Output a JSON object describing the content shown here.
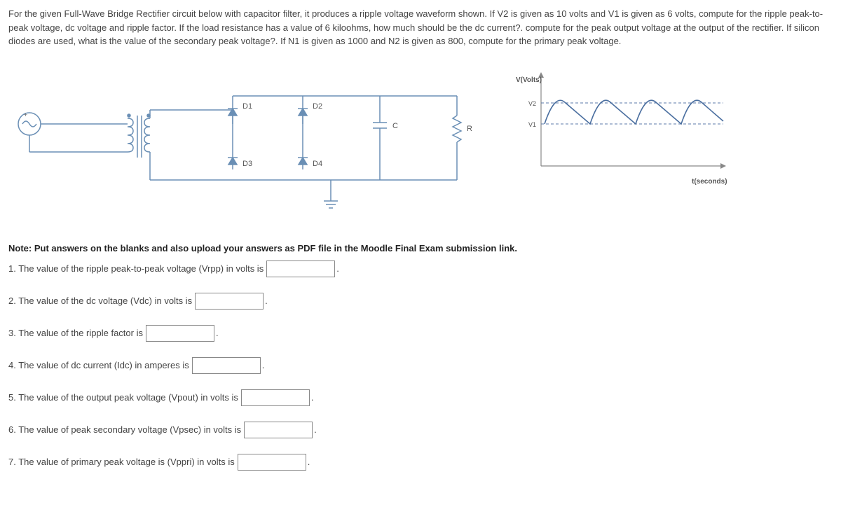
{
  "problem": {
    "text": "For the given Full-Wave Bridge Rectifier circuit below with capacitor filter, it produces a ripple voltage waveform shown. If V2 is given as 10 volts and V1 is given as 6 volts, compute for the ripple peak-to-peak voltage, dc voltage and ripple factor. If the load resistance has a value of 6 kiloohms, how much should be the dc current?. compute for the peak output voltage at the output of the rectifier. If silicon diodes are used, what is the value of the secondary peak voltage?. If N1 is given as 1000 and N2 is given as 800, compute for the primary peak voltage."
  },
  "circuit": {
    "d1": "D1",
    "d2": "D2",
    "d3": "D3",
    "d4": "D4",
    "c": "C",
    "r": "R"
  },
  "waveform": {
    "ylabel": "V(Volts)",
    "v2": "V2",
    "v1": "V1",
    "xlabel": "t(seconds)"
  },
  "note": "Note: Put answers on the blanks and also upload your answers as PDF file in the Moodle Final Exam submission link.",
  "questions": {
    "q1_pre": "1. The value of the ripple peak-to-peak voltage (Vrpp) in volts is",
    "q1_post": ".",
    "q2_pre": "2. The value of the dc voltage (Vdc) in volts is",
    "q2_post": ".",
    "q3_pre": "3.  The value of the ripple factor is",
    "q3_post": ".",
    "q4_pre": "4. The value of dc current (Idc) in amperes is",
    "q4_post": ".",
    "q5_pre": "5. The value of the output peak voltage (Vpout) in volts is",
    "q5_post": ".",
    "q6_pre": "6. The value of peak secondary voltage (Vpsec) in volts is",
    "q6_post": ".",
    "q7_pre": "7. The value of primary peak voltage is (Vppri) in volts is",
    "q7_post": "."
  },
  "chart_data": {
    "type": "line",
    "title": "Ripple voltage waveform",
    "xlabel": "t(seconds)",
    "ylabel": "V(Volts)",
    "ylim": [
      0,
      12
    ],
    "reference_levels": {
      "V2": 10,
      "V1": 6
    },
    "description": "Sawtooth ripple between V2 (10V) peaks and V1 (6V) troughs, repeating"
  }
}
